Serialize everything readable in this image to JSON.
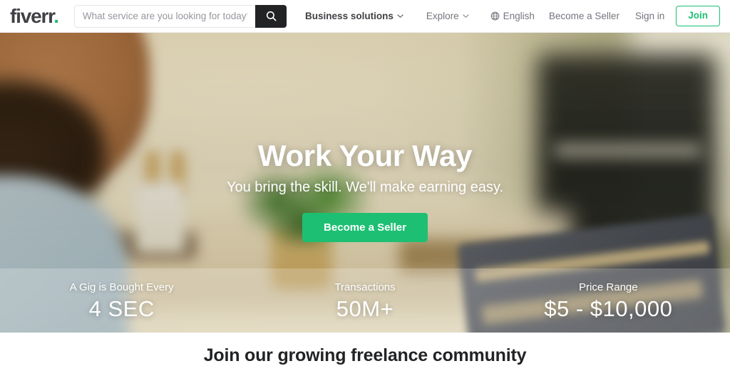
{
  "header": {
    "logo": {
      "text": "fiverr",
      "dot": ".",
      "dot_color": "#1dbf73"
    },
    "search": {
      "placeholder": "What service are you looking for today?",
      "value": "",
      "button_icon": "search-icon",
      "button_color": "#222325"
    },
    "nav": [
      {
        "label": "Business solutions",
        "icon": "chevron-down-icon",
        "has_caret": true,
        "emphasis": "strong"
      },
      {
        "label": "Explore",
        "icon": "chevron-down-icon",
        "has_caret": true,
        "emphasis": "normal"
      },
      {
        "label": "English",
        "icon": "globe-icon",
        "has_caret": false,
        "emphasis": "normal"
      },
      {
        "label": "Become a Seller",
        "icon": "",
        "has_caret": false,
        "emphasis": "normal"
      },
      {
        "label": "Sign in",
        "icon": "",
        "has_caret": false,
        "emphasis": "normal"
      }
    ],
    "join_button": {
      "label": "Join",
      "color": "#1dbf73"
    }
  },
  "hero": {
    "title": "Work Your Way",
    "subtitle": "You bring the skill. We'll make earning easy.",
    "cta": {
      "label": "Become a Seller",
      "color": "#1dbf73"
    }
  },
  "stats": [
    {
      "label": "A Gig is Bought Every",
      "value": "4 SEC"
    },
    {
      "label": "Transactions",
      "value": "50M+"
    },
    {
      "label": "Price Range",
      "value": "$5 - $10,000"
    }
  ],
  "bottom": {
    "title": "Join our growing freelance community"
  }
}
